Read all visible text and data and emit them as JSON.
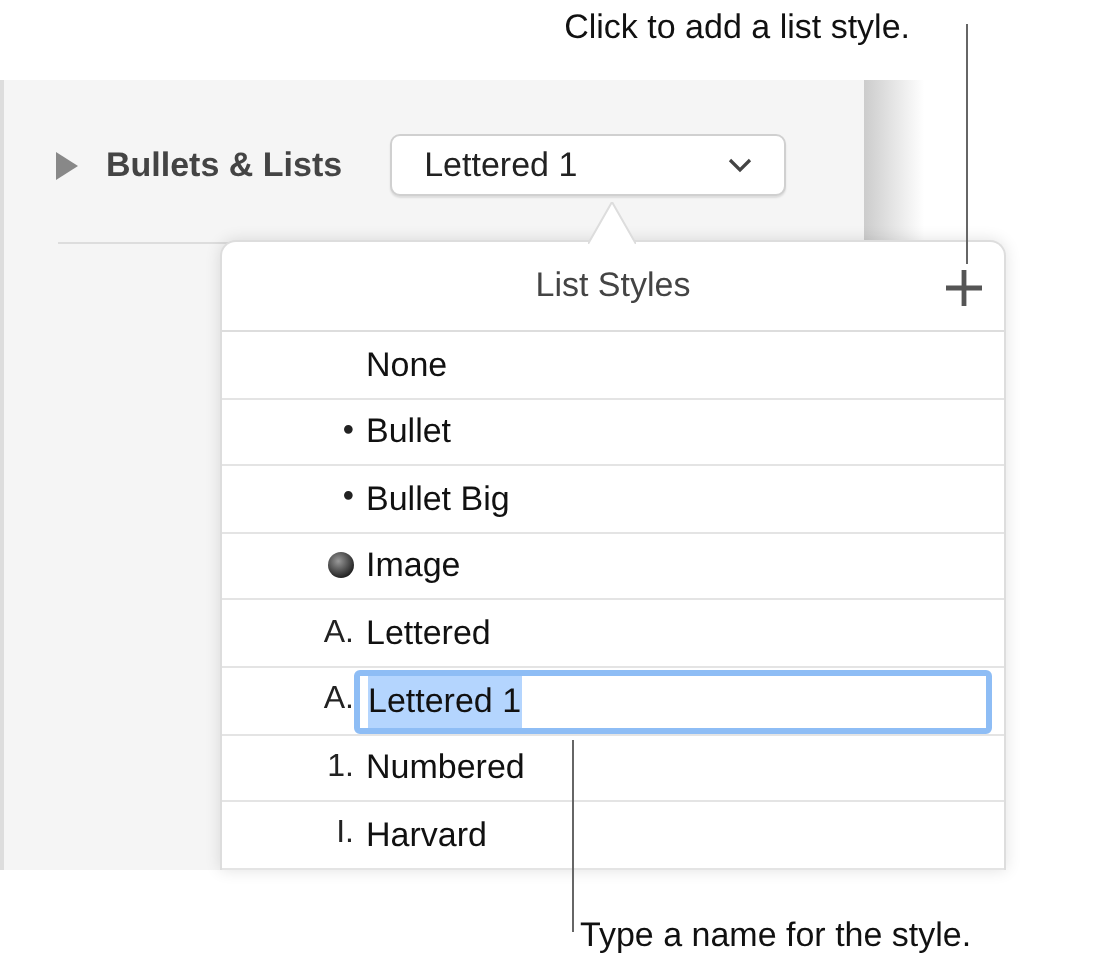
{
  "callouts": [
    {
      "text": "Click to add a list style."
    },
    {
      "text": "Type a name for the style."
    }
  ],
  "section": {
    "title": "Bullets & Lists",
    "expanded": false,
    "popup_value": "Lettered 1"
  },
  "popover": {
    "title": "List Styles",
    "items": [
      {
        "kind": "none",
        "label": "None",
        "editing": false
      },
      {
        "kind": "text",
        "marker": "•",
        "label": "Bullet",
        "editing": false
      },
      {
        "kind": "text",
        "marker": "•",
        "label": "Bullet Big",
        "editing": false
      },
      {
        "kind": "image",
        "label": "Image",
        "editing": false
      },
      {
        "kind": "text",
        "marker": "A.",
        "label": "Lettered",
        "editing": false
      },
      {
        "kind": "text",
        "marker": "A.",
        "label": "Lettered 1",
        "editing": true
      },
      {
        "kind": "text",
        "marker": "1.",
        "label": "Numbered",
        "editing": false
      },
      {
        "kind": "text",
        "marker": "I.",
        "label": "Harvard",
        "editing": false
      }
    ]
  }
}
